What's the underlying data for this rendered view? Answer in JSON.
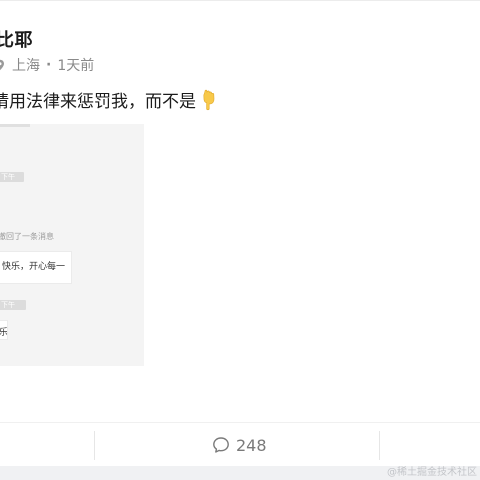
{
  "post": {
    "author_name": "比耶",
    "location": "上海",
    "separator": "·",
    "time_ago": "1天前",
    "text": "请用法律来惩罚我，而不是",
    "emoji": "backhand-index-pointing-down"
  },
  "image": {
    "chat_time_1": "下午",
    "chat_system_msg": "撤回了一条消息",
    "chat_bubble_1": "快乐，开心每一",
    "chat_time_2": "下午",
    "chat_bubble_2": "乐"
  },
  "actions": {
    "comment_count": "248",
    "comment_icon": "comment-bubble-icon"
  },
  "watermark": "@稀土掘金技术社区",
  "colors": {
    "text_primary": "#1c1c1c",
    "text_secondary": "#8a8a8a",
    "image_bg": "#f4f4f4",
    "bottom_strip": "#f0f1f3"
  }
}
